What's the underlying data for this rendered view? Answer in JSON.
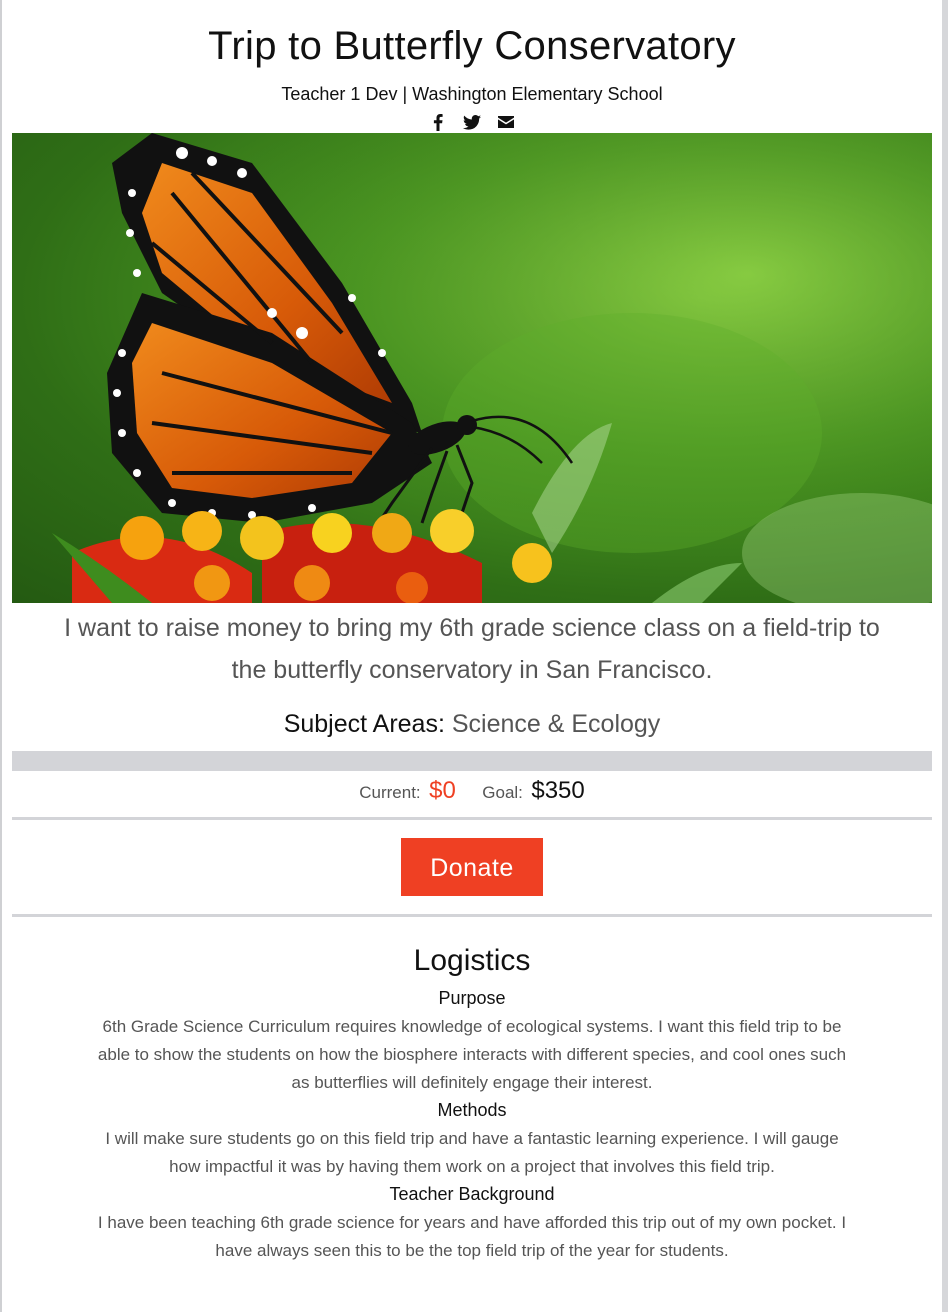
{
  "campaign": {
    "title": "Trip to Butterfly Conservatory",
    "byline": "Teacher 1 Dev | Washington Elementary School",
    "summary": "I want to raise money to bring my 6th grade science class on a field-trip to the butterfly conservatory in San Francisco.",
    "subject_label": "Subject Areas:",
    "subject_value": "Science & Ecology"
  },
  "social": [
    "facebook-icon",
    "twitter-icon",
    "mail-icon"
  ],
  "funding": {
    "current_label": "Current:",
    "current_value": "$0",
    "goal_label": "Goal:",
    "goal_value": "$350",
    "progress_fraction": 0
  },
  "donate": {
    "label": "Donate"
  },
  "logistics": {
    "heading": "Logistics",
    "purpose_title": "Purpose",
    "purpose_text": "6th Grade Science Curriculum requires knowledge of ecological systems. I want this field trip to be able to show the students on how the biosphere interacts with different species, and cool ones such as butterflies will definitely engage their interest.",
    "methods_title": "Methods",
    "methods_text": "I will make sure students go on this field trip and have a fantastic learning experience. I will gauge how impactful it was by having them work on a project that involves this field trip.",
    "background_title": "Teacher Background",
    "background_text": "I have been teaching 6th grade science for years and have afforded this trip out of my own pocket. I have always seen this to be the top field trip of the year for students."
  },
  "colors": {
    "accent": "#ef4023",
    "progress_track": "#d3d4d8",
    "muted_text": "#555555"
  }
}
